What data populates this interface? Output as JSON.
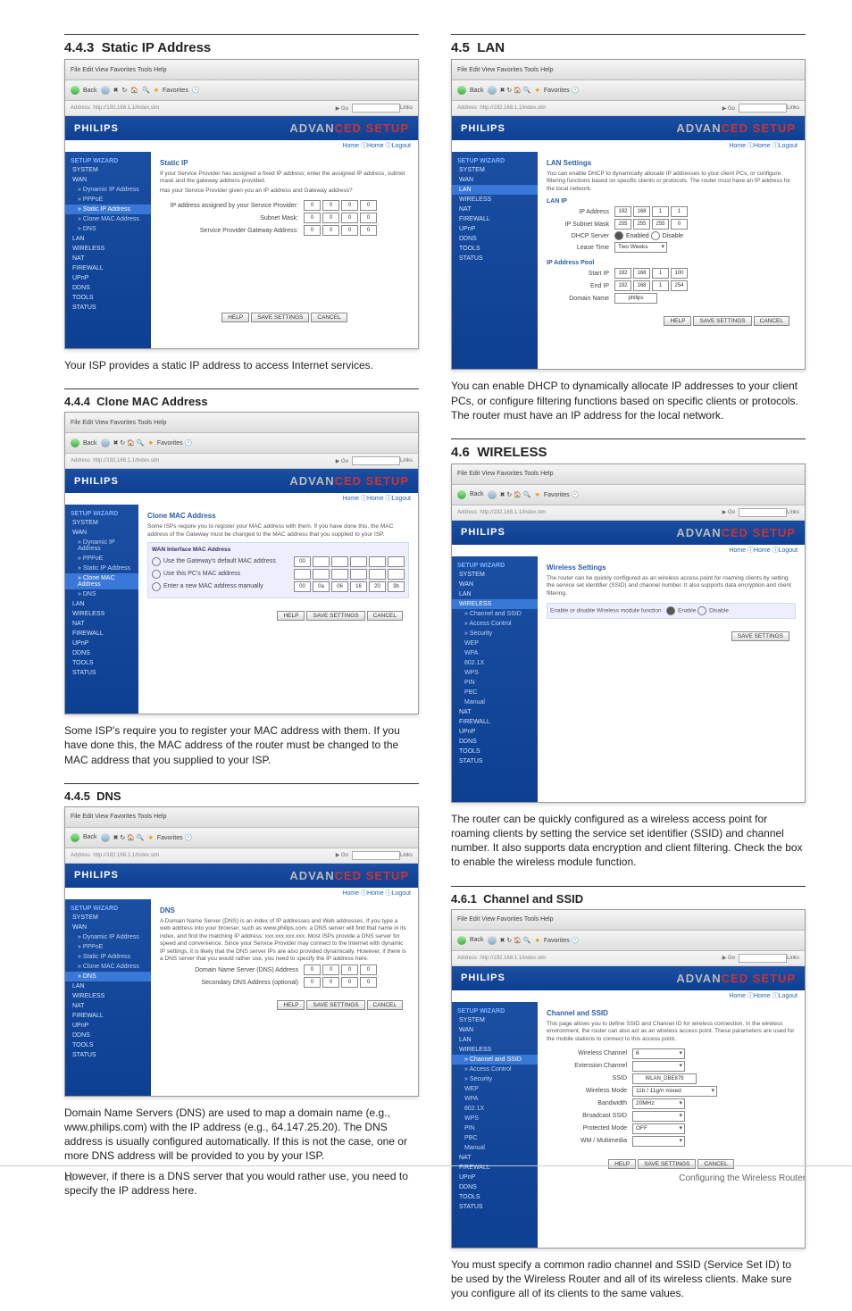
{
  "sections": {
    "static_ip": {
      "num": "4.4.3",
      "title": "Static IP Address",
      "body": "Your ISP provides a static IP address to access Internet services."
    },
    "clone_mac": {
      "num": "4.4.4",
      "title": "Clone MAC Address",
      "body": "Some ISP's require you to register your MAC address with them. If you have done this, the MAC address of the router must be changed to the MAC address that you supplied to your ISP."
    },
    "dns": {
      "num": "4.4.5",
      "title": "DNS",
      "body1": "Domain Name Servers (DNS) are used to map a domain name (e.g., www.philips.com) with the IP address (e.g., 64.147.25.20). The DNS address is usually configured automatically. If this is not the case, one or more DNS address will be provided to you by your ISP.",
      "body2": "However, if there is a DNS server that you would rather use, you need to specify the IP address here."
    },
    "lan": {
      "num": "4.5",
      "title": "LAN",
      "body": "You can enable DHCP to dynamically allocate IP addresses to your client PCs, or configure filtering functions based on specific clients or protocols. The router must have an IP address for the local network."
    },
    "wireless": {
      "num": "4.6",
      "title": "WIRELESS",
      "body": "The router can be quickly configured as a wireless access point for roaming clients by setting the service set identifier (SSID) and channel number. It also supports data encryption and client filtering. Check the box to enable the wireless module function."
    },
    "ssid": {
      "num": "4.6.1",
      "title": "Channel and SSID",
      "body": "You must specify a common radio channel and SSID (Service Set ID) to be used by the Wireless Router and all of its wireless clients. Make sure you configure all of its clients to the same values."
    }
  },
  "brand": "PHILIPS",
  "adv_label": "ADVANCED SETUP",
  "adv_sub": "Home  ⓘHome  ⓘLogout",
  "ie": {
    "menu": "File  Edit  View  Favorites  Tools  Help",
    "back": "Back",
    "addr_go": "Go",
    "addr_label": "Address",
    "addr_value": "http://192.168.1.1/index.stm",
    "links": "Links"
  },
  "btns": {
    "help": "HELP",
    "save": "SAVE SETTINGS",
    "cancel": "CANCEL"
  },
  "menu": {
    "wizard": "SETUP WIZARD",
    "items_wan": [
      "SYSTEM",
      "WAN",
      "» Dynamic IP Address",
      "» PPPoE",
      "» Static IP Address",
      "» Clone MAC Address",
      "» DNS",
      "LAN",
      "WIRELESS",
      "NAT",
      "FIREWALL",
      "UPnP",
      "DDNS",
      "TOOLS",
      "STATUS"
    ],
    "items_lan": [
      "SYSTEM",
      "WAN",
      "LAN",
      "WIRELESS",
      "NAT",
      "FIREWALL",
      "UPnP",
      "DDNS",
      "TOOLS",
      "STATUS"
    ],
    "items_wl": [
      "SYSTEM",
      "WAN",
      "LAN",
      "WIRELESS",
      "» Channel and SSID",
      "» Access Control",
      "» Security",
      "  WEP",
      "  WPA",
      "  802.1X",
      "  WPS",
      "  PIN",
      "  PBC",
      "  Manual",
      "NAT",
      "FIREWALL",
      "UPnP",
      "DDNS",
      "TOOLS",
      "STATUS"
    ]
  },
  "static": {
    "heading": "Static IP",
    "desc": "If your Service Provider has assigned a fixed IP address; enter the assigned IP address, subnet mask and the gateway address provided.",
    "desc2": "Has your Service Provider given you an IP address and Gateway address?",
    "r1": "IP address assigned by your Service Provider:",
    "v1": [
      "0",
      "0",
      "0",
      "0"
    ],
    "r2": "Subnet Mask:",
    "v2": [
      "0",
      "0",
      "0",
      "0"
    ],
    "r3": "Service Provider Gateway Address:",
    "v3": [
      "0",
      "0",
      "0",
      "0"
    ]
  },
  "clone": {
    "heading": "Clone MAC Address",
    "desc": "Some ISPs require you to register your MAC address with them. If you have done this, the MAC address of the Gateway must be changed to the MAC address that you supplied to your ISP.",
    "sub": "WAN Interface MAC Address",
    "opt1": "Use the Gateway's default MAC address",
    "m1": [
      "00",
      "",
      "",
      "",
      "",
      ""
    ],
    "opt2": "Use this PC's MAC address",
    "m2": [
      "",
      "",
      "",
      "",
      "",
      ""
    ],
    "opt3": "Enter a new MAC address manually",
    "m3": [
      "00",
      "0a",
      "06",
      "16",
      "20",
      "3b"
    ]
  },
  "dns_shot": {
    "heading": "DNS",
    "desc": "A Domain Name Server (DNS) is an index of IP addresses and Web addresses. If you type a web address into your browser, such as www.philips.com, a DNS server will find that name in its index, and find the matching IP address: xxx.xxx.xxx.xxx. Most ISPs provide a DNS server for speed and convenience. Since your Service Provider may connect to the Internet with dynamic IP settings, it is likely that the DNS server IPs are also provided dynamically. However, if there is a DNS server that you would rather use, you need to specify the IP address here.",
    "r1": "Domain Name Server (DNS) Address",
    "v1": [
      "0",
      "0",
      "0",
      "0"
    ],
    "r2": "Secondary DNS Address (optional)",
    "v2": [
      "0",
      "0",
      "0",
      "0"
    ]
  },
  "lan_shot": {
    "heading": "LAN Settings",
    "desc": "You can enable DHCP to dynamically allocate IP addresses to your client PCs, or configure filtering functions based on specific clients or protocols. The router must have an IP address for the local network.",
    "sub1": "LAN IP",
    "r1": "IP Address",
    "v1": [
      "192",
      "168",
      "1",
      "1"
    ],
    "r2": "IP Subnet Mask",
    "v2": [
      "255",
      "255",
      "255",
      "0"
    ],
    "r3": "DHCP Server",
    "en": "Enabled",
    "dis": "Disable",
    "r4": "Lease Time",
    "lease": "Two Weeks",
    "sub2": "IP Address Pool",
    "r5": "Start IP",
    "v5": [
      "192",
      "168",
      "1",
      "100"
    ],
    "r6": "End IP",
    "v6": [
      "192",
      "168",
      "1",
      "254"
    ],
    "r7": "Domain Name",
    "dom": "philips"
  },
  "wl_shot": {
    "heading": "Wireless Settings",
    "desc": "The router can be quickly configured as an wireless access point for roaming clients by setting the service set identifier (SSID) and channel number. It also supports data encryption and client filtering.",
    "opt": "Enable or disable Wireless module function :",
    "en": "Enable",
    "dis": "Disable"
  },
  "ssid_shot": {
    "heading": "Channel and SSID",
    "desc": "This page allows you to define SSID and Channel ID for wireless connection. In the wireless environment, the router can also act as an wireless access point. These parameters are used for the mobile stations to connect to this access point.",
    "r1": "Wireless Channel",
    "ch": "6",
    "r2": "Extension Channel",
    "ext": "",
    "r3": "SSID",
    "ssid": "WLAN_DBE879",
    "r4": "Wireless Mode",
    "mode": "11b / 11g/n mixed",
    "r5": "Bandwidth",
    "bw": "20MHz",
    "r6": "Broadcast SSID",
    "bc": "",
    "r7": "Protected Mode",
    "pm": "OFF",
    "r8": "WM / Multimedia",
    "wm": ""
  },
  "footer": {
    "page": "10",
    "title": "Configuring the Wireless Router"
  }
}
